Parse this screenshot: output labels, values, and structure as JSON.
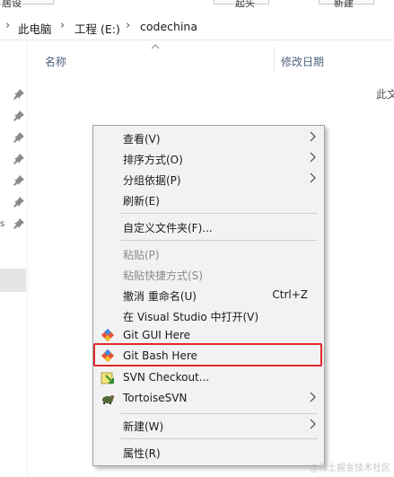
{
  "ribbon": {
    "left_fragment": "居设",
    "mid_fragment": "起头",
    "right_fragment": "新建"
  },
  "breadcrumb": {
    "items": [
      {
        "label": "此电脑"
      },
      {
        "label": "工程 (E:)"
      },
      {
        "label": "codechina"
      }
    ]
  },
  "columns": {
    "name": "名称",
    "date_modified": "修改日期"
  },
  "clipped_right_text": "此文",
  "left_mark": "s",
  "context_menu": {
    "items": [
      {
        "label": "查看(V)",
        "has_submenu": true,
        "disabled": false
      },
      {
        "label": "排序方式(O)",
        "has_submenu": true,
        "disabled": false
      },
      {
        "label": "分组依据(P)",
        "has_submenu": true,
        "disabled": false
      },
      {
        "label": "刷新(E)",
        "has_submenu": false,
        "disabled": false
      },
      {
        "label": "自定义文件夹(F)...",
        "has_submenu": false,
        "disabled": false
      },
      {
        "label": "粘贴(P)",
        "has_submenu": false,
        "disabled": true
      },
      {
        "label": "粘贴快捷方式(S)",
        "has_submenu": false,
        "disabled": true
      },
      {
        "label": "撤消 重命名(U)",
        "shortcut": "Ctrl+Z",
        "has_submenu": false,
        "disabled": false
      },
      {
        "label": "在 Visual Studio 中打开(V)",
        "has_submenu": false,
        "disabled": false
      },
      {
        "label": "Git GUI Here",
        "icon": "git-icon",
        "has_submenu": false,
        "disabled": false
      },
      {
        "label": "Git Bash Here",
        "icon": "git-icon",
        "has_submenu": false,
        "disabled": false,
        "highlighted": true
      },
      {
        "label": "SVN Checkout...",
        "icon": "svn-checkout-icon",
        "has_submenu": false,
        "disabled": false
      },
      {
        "label": "TortoiseSVN",
        "icon": "tortoisesvn-icon",
        "has_submenu": true,
        "disabled": false
      },
      {
        "label": "新建(W)",
        "has_submenu": true,
        "disabled": false
      },
      {
        "label": "属性(R)",
        "has_submenu": false,
        "disabled": false
      }
    ]
  },
  "colors": {
    "highlight_border": "#e3282c",
    "menu_bg": "#f2f2f2",
    "header_text": "#4c607a"
  },
  "watermark": "@稀土掘金技术社区"
}
